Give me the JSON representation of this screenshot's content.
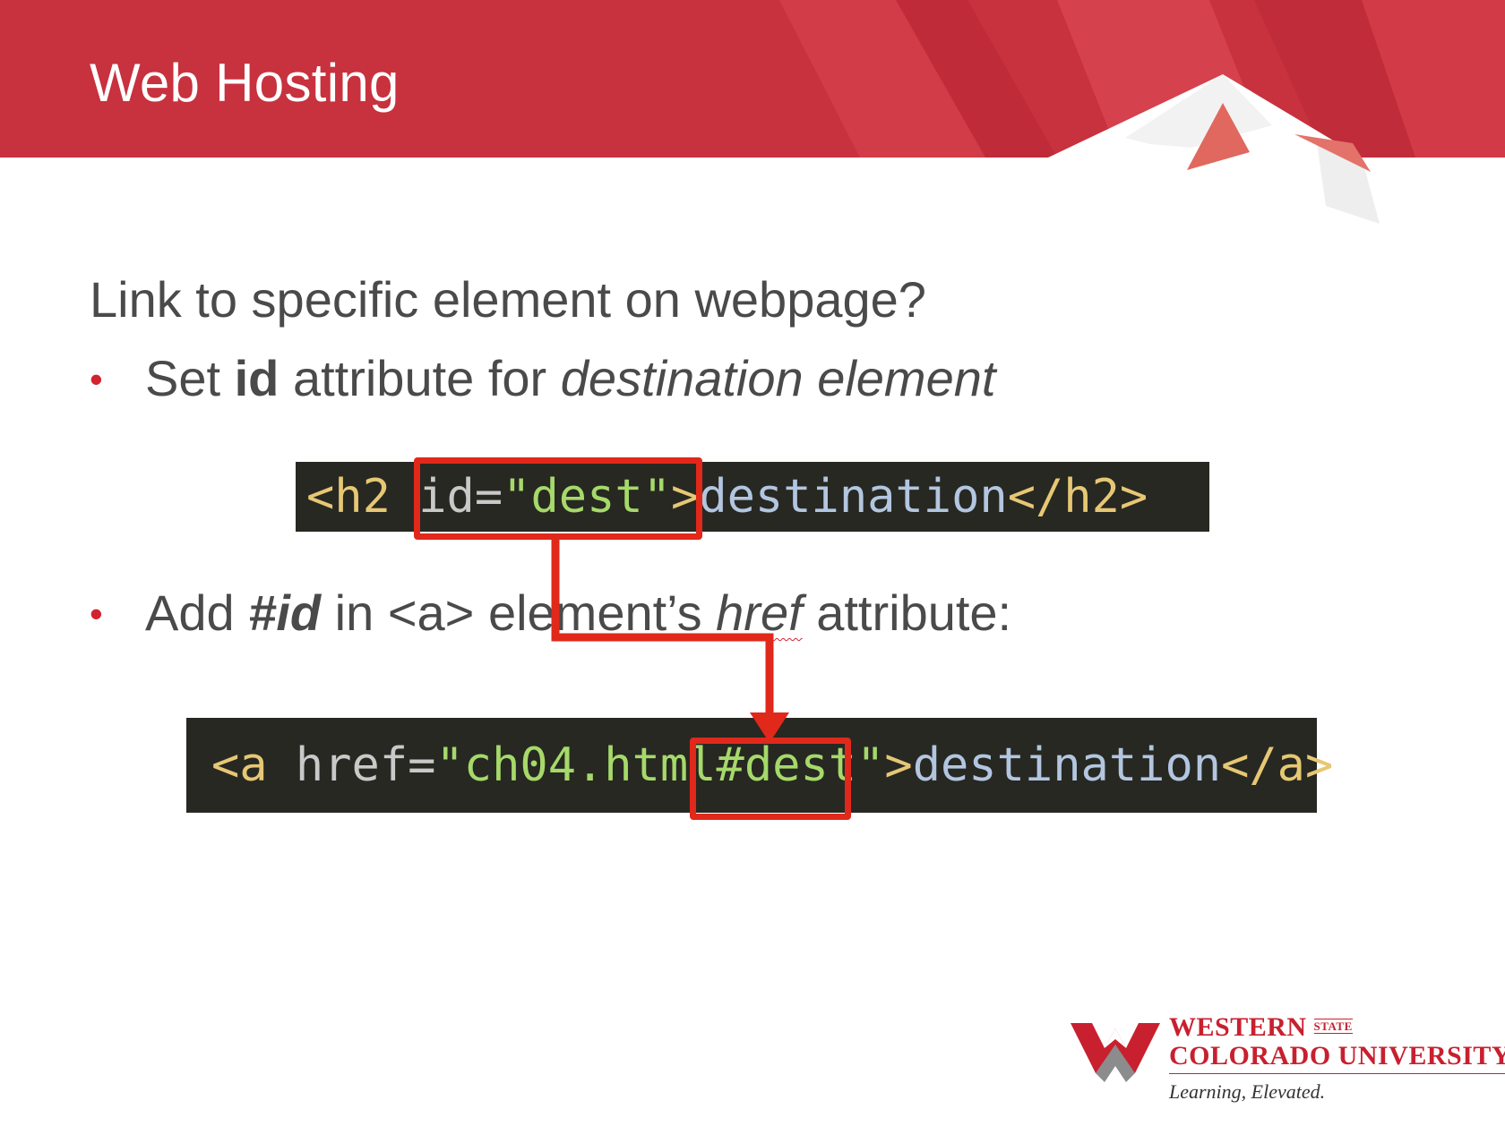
{
  "slide": {
    "title": "Web Hosting",
    "heading": "Link to specific element on webpage?"
  },
  "bullets": {
    "b1_pre": "Set ",
    "b1_bold": "id",
    "b1_mid": " attribute for ",
    "b1_italic": "destination element",
    "b2_pre": "Add ",
    "b2_bolditalic": "#id",
    "b2_mid": " in <a> element’s ",
    "b2_italic": "href",
    "b2_post": " attribute:"
  },
  "code1": {
    "open": "<h2 ",
    "attr": "id=",
    "value": "\"dest\"",
    "close": ">",
    "text": "destination",
    "end": "</h2>"
  },
  "code2": {
    "open": "<a ",
    "attr": "href=",
    "value": "\"ch04.html#dest\"",
    "close": ">",
    "text": "destination",
    "end": "</a>"
  },
  "colors": {
    "brand_red": "#c8202f",
    "highlight_red": "#e0281b",
    "code_bg": "#272822"
  },
  "logo": {
    "name_line1": "WESTERN",
    "state": "STATE",
    "name_line2": "COLORADO UNIVERSITY",
    "tagline": "Learning, Elevated."
  }
}
